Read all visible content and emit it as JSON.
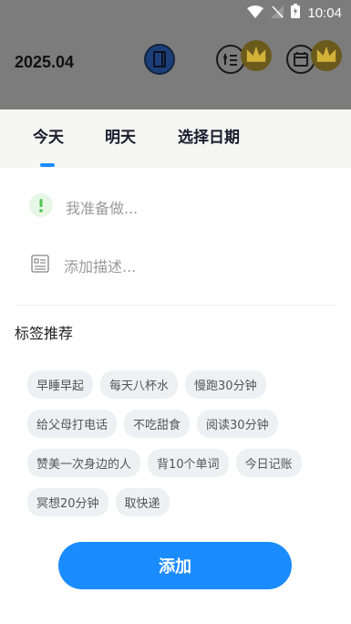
{
  "status_bar": {
    "time": "10:04"
  },
  "header": {
    "date": "2025.04",
    "icons": [
      "notebook-icon",
      "list-settings-icon",
      "calendar-icon"
    ]
  },
  "tabs": [
    {
      "label": "今天",
      "active": true
    },
    {
      "label": "明天",
      "active": false
    },
    {
      "label": "选择日期",
      "active": false
    }
  ],
  "form": {
    "title_placeholder": "我准备做...",
    "desc_placeholder": "添加描述..."
  },
  "tags": {
    "title": "标签推荐",
    "rows": [
      [
        "早睡早起",
        "每天八杯水",
        "慢跑30分钟"
      ],
      [
        "给父母打电话",
        "不吃甜食",
        "阅读30分钟"
      ],
      [
        "赞美一次身边的人",
        "背10个单词",
        "今日记账"
      ],
      [
        "冥想20分钟",
        "取快递"
      ]
    ]
  },
  "actions": {
    "add_label": "添加"
  },
  "colors": {
    "accent": "#1a8cff",
    "overlay": "#7c7c7c",
    "chip_bg": "#eef0f4"
  }
}
